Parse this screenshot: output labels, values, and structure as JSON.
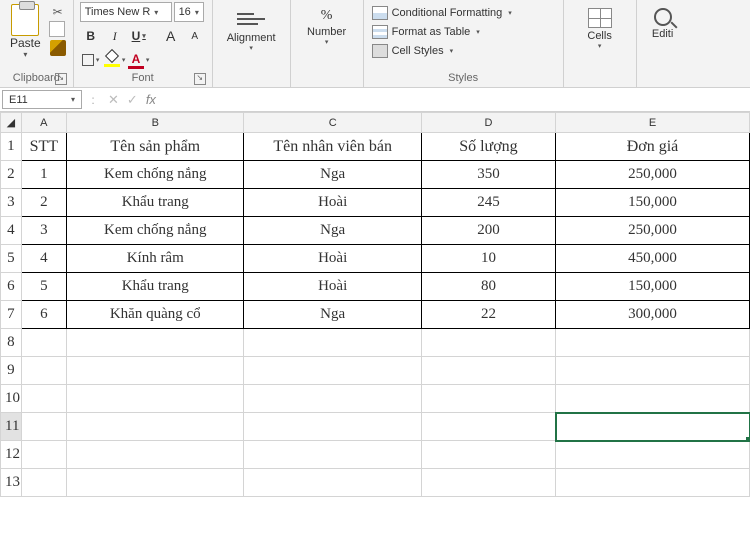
{
  "ribbon": {
    "clipboard": {
      "paste": "Paste",
      "title": "Clipboard"
    },
    "font": {
      "name": "Times New R",
      "size": "16",
      "bold": "B",
      "italic": "I",
      "underline": "U",
      "grow": "A",
      "shrink": "A",
      "fontcolor": "A",
      "title": "Font"
    },
    "alignment": {
      "label": "Alignment"
    },
    "number": {
      "label": "Number"
    },
    "styles": {
      "cond": "Conditional Formatting",
      "table": "Format as Table",
      "cell": "Cell Styles",
      "title": "Styles"
    },
    "cells": {
      "label": "Cells"
    },
    "editing": {
      "label": "Editi"
    }
  },
  "namebox": "E11",
  "fx": "fx",
  "formula": "",
  "columns": [
    "A",
    "B",
    "C",
    "D",
    "E"
  ],
  "selected": {
    "col": "E",
    "row": 11
  },
  "headers": {
    "stt": "STT",
    "product": "Tên sản phẩm",
    "seller": "Tên nhân viên bán",
    "qty": "Số lượng",
    "price": "Đơn giá"
  },
  "rows": [
    {
      "stt": "1",
      "product": "Kem chống nắng",
      "seller": "Nga",
      "qty": "350",
      "price": "250,000"
    },
    {
      "stt": "2",
      "product": "Khẩu trang",
      "seller": "Hoài",
      "qty": "245",
      "price": "150,000"
    },
    {
      "stt": "3",
      "product": "Kem chống nắng",
      "seller": "Nga",
      "qty": "200",
      "price": "250,000"
    },
    {
      "stt": "4",
      "product": "Kính râm",
      "seller": "Hoài",
      "qty": "10",
      "price": "450,000"
    },
    {
      "stt": "5",
      "product": "Khẩu trang",
      "seller": "Hoài",
      "qty": "80",
      "price": "150,000"
    },
    {
      "stt": "6",
      "product": "Khăn quàng cổ",
      "seller": "Nga",
      "qty": "22",
      "price": "300,000"
    }
  ]
}
